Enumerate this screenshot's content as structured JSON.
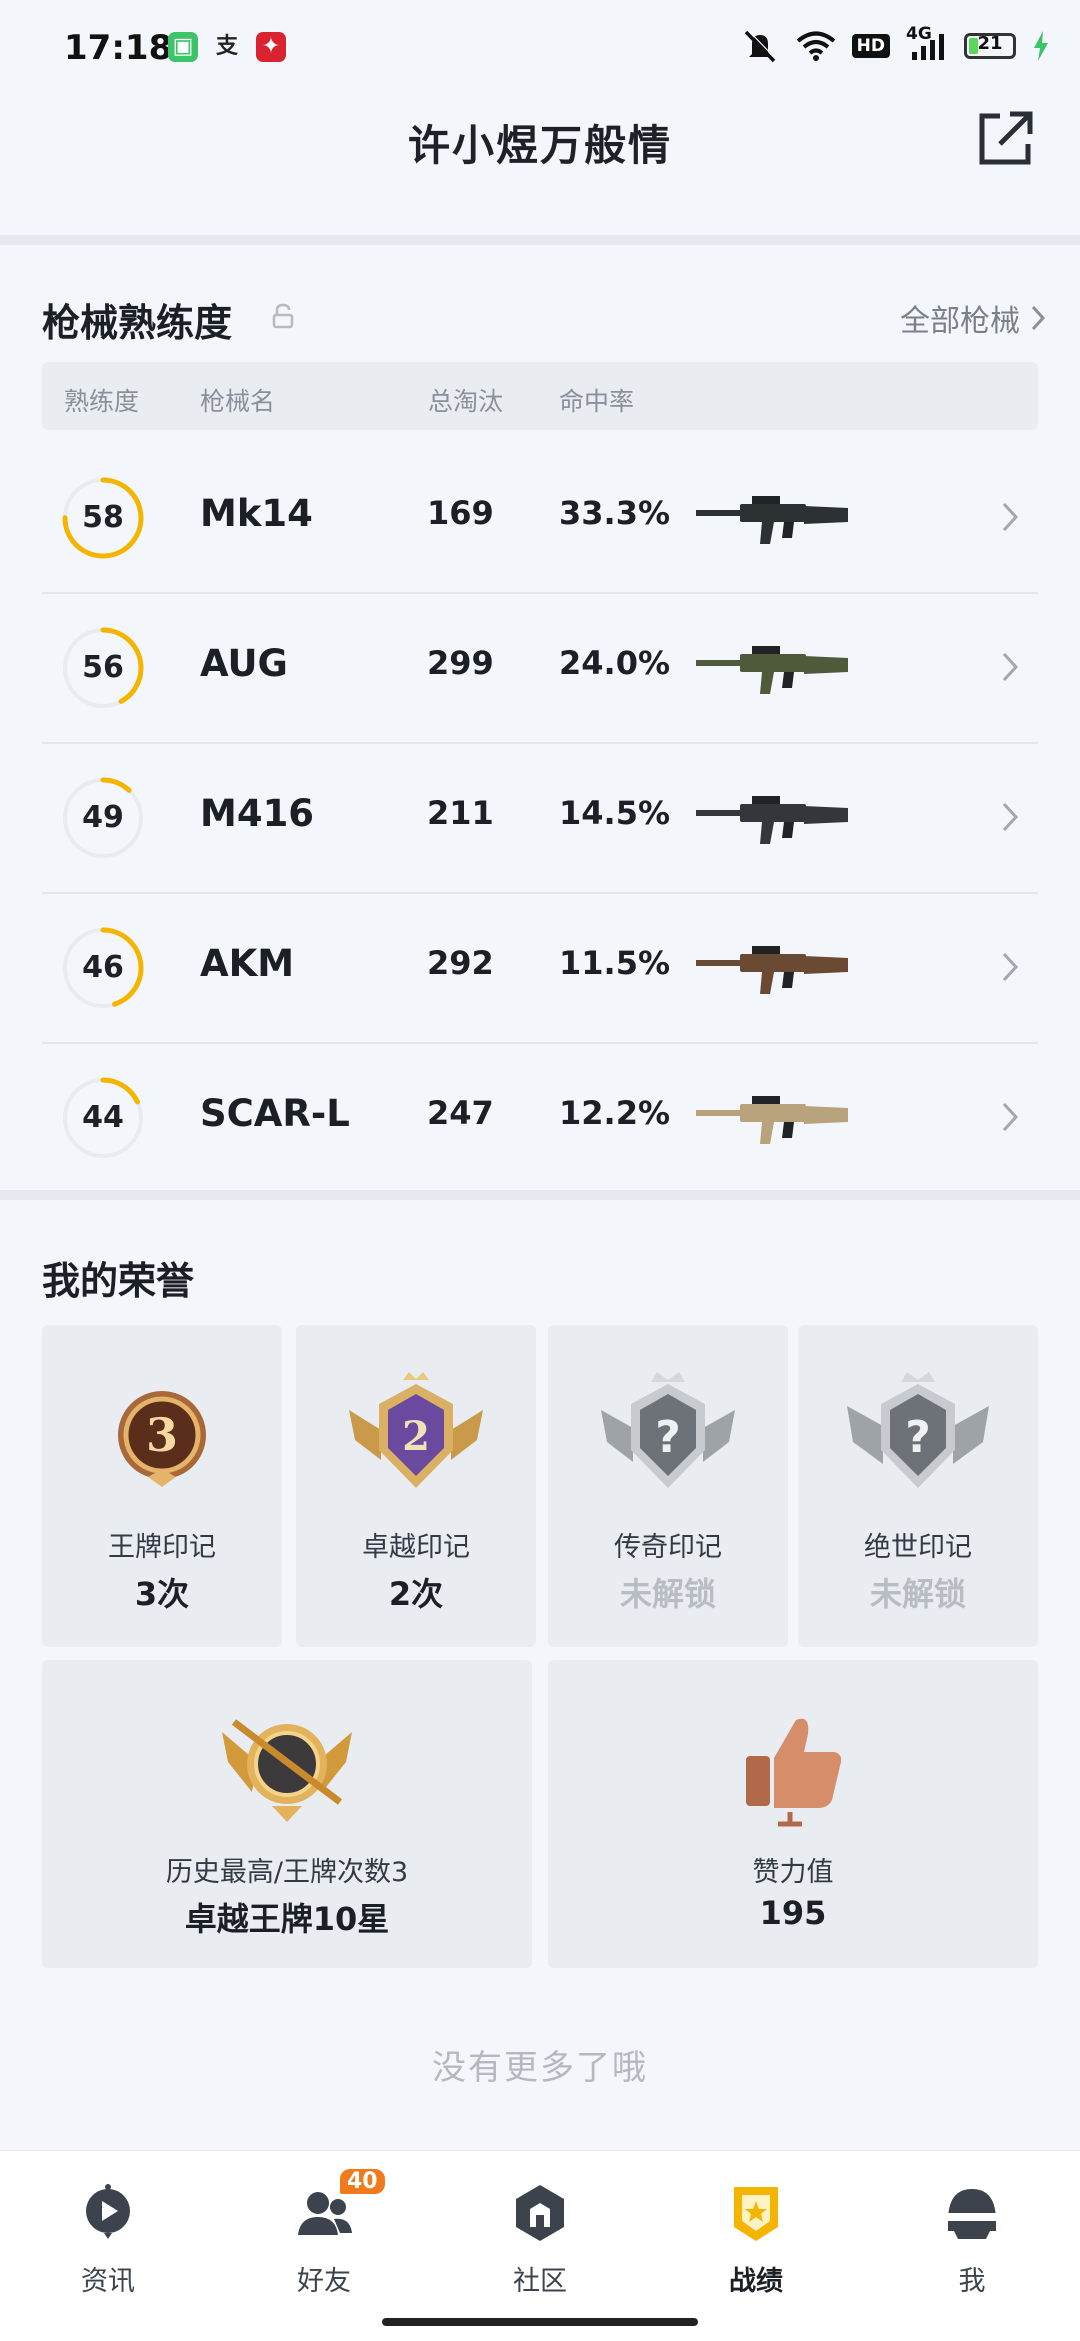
{
  "status_bar": {
    "time": "17:18",
    "app_icons": [
      {
        "icon": "messages-app-icon",
        "glyph": "▣",
        "color": "#3cc46a"
      },
      {
        "icon": "alipay-app-icon",
        "glyph": "支",
        "color": "#222222"
      },
      {
        "icon": "game-app-icon",
        "glyph": "✦",
        "color": "#d9232e"
      }
    ],
    "hd": "HD",
    "network": "4G",
    "battery": "21",
    "battery_level": 0.21
  },
  "header": {
    "title": "许小煜万般情"
  },
  "weapons": {
    "title": "枪械熟练度",
    "all_link": "全部枪械",
    "columns": {
      "proficiency": "熟练度",
      "name": "枪械名",
      "kills": "总淘汰",
      "accuracy": "命中率"
    },
    "rows": [
      {
        "proficiency": "58",
        "progress": 0.75,
        "name": "Mk14",
        "kills": "169",
        "accuracy": "33.3%",
        "gun_color": "#2c3134"
      },
      {
        "proficiency": "56",
        "progress": 0.42,
        "name": "AUG",
        "kills": "299",
        "accuracy": "24.0%",
        "gun_color": "#4f5a3a"
      },
      {
        "proficiency": "49",
        "progress": 0.12,
        "name": "M416",
        "kills": "211",
        "accuracy": "14.5%",
        "gun_color": "#33373b"
      },
      {
        "proficiency": "46",
        "progress": 0.45,
        "name": "AKM",
        "kills": "292",
        "accuracy": "11.5%",
        "gun_color": "#6b4a34"
      },
      {
        "proficiency": "44",
        "progress": 0.18,
        "name": "SCAR-L",
        "kills": "247",
        "accuracy": "12.2%",
        "gun_color": "#b9a37d"
      }
    ]
  },
  "honors": {
    "title": "我的荣誉",
    "marks": [
      {
        "label": "王牌印记",
        "value": "3次",
        "locked": false,
        "badge_text": "3"
      },
      {
        "label": "卓越印记",
        "value": "2次",
        "locked": false,
        "badge_text": "2"
      },
      {
        "label": "传奇印记",
        "value": "未解锁",
        "locked": true,
        "badge_text": "?"
      },
      {
        "label": "绝世印记",
        "value": "未解锁",
        "locked": true,
        "badge_text": "?"
      }
    ],
    "history": {
      "label": "历史最高/王牌次数3",
      "value": "卓越王牌10星"
    },
    "likes": {
      "label": "赞力值",
      "value": "195"
    }
  },
  "footer_note": "没有更多了哦",
  "nav": {
    "items": [
      {
        "label": "资讯",
        "icon": "news-play-icon"
      },
      {
        "label": "好友",
        "icon": "friends-icon",
        "badge": "40"
      },
      {
        "label": "社区",
        "icon": "community-icon"
      },
      {
        "label": "战绩",
        "icon": "record-medal-icon",
        "active": true
      },
      {
        "label": "我",
        "icon": "helmet-profile-icon"
      }
    ]
  },
  "colors": {
    "accent": "#f5b400",
    "ring_track": "#e8ebef"
  }
}
